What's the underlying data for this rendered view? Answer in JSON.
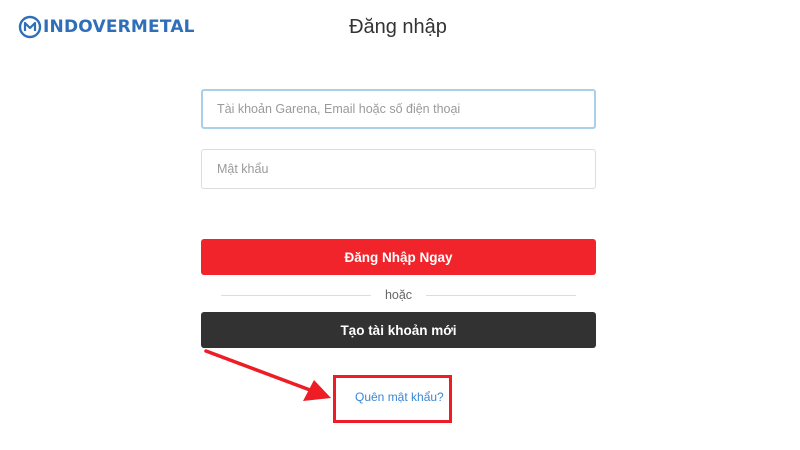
{
  "logo": {
    "text": "INDOVERMETAL",
    "icon": "m-logo-icon",
    "color": "#2f6fb8"
  },
  "page": {
    "title": "Đăng nhập"
  },
  "form": {
    "username_placeholder": "Tài khoản Garena, Email hoặc số điện thoại",
    "password_placeholder": "Mật khẩu",
    "login_button": "Đăng Nhập Ngay",
    "divider_text": "hoặc",
    "register_button": "Tạo tài khoản mới",
    "forgot_link": "Quên mật khẩu?"
  },
  "colors": {
    "login_button": "#f0242a",
    "register_button": "#333232",
    "link": "#3b86d4",
    "annotation": "#ee1c24"
  }
}
